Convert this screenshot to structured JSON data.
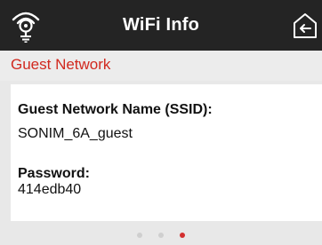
{
  "header": {
    "title": "WiFi Info",
    "left_icon": "wifi-hotspot-icon",
    "right_icon": "back-icon"
  },
  "section": {
    "title": "Guest Network"
  },
  "details": {
    "ssid_label": "Guest Network Name (SSID):",
    "ssid_value": "SONIM_6A_guest",
    "password_label": "Password:",
    "password_value": "414edb40"
  },
  "pager": {
    "page_count": 3,
    "active_index": 2
  },
  "colors": {
    "header_bg": "#242424",
    "accent": "#d1291f",
    "background": "#e8e8e8",
    "card_bg": "#ffffff"
  }
}
